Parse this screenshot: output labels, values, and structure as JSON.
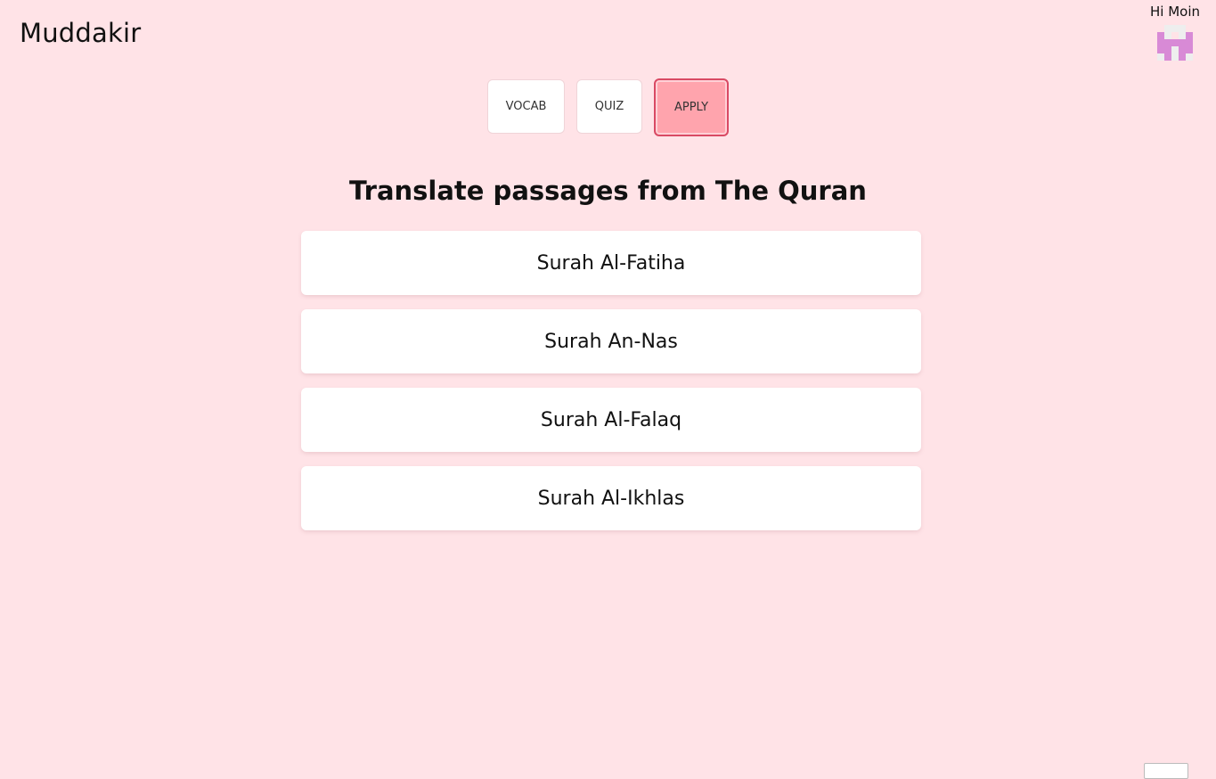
{
  "header": {
    "app_title": "Muddakir",
    "greeting": "Hi Moin",
    "avatar_icon": "pixel-avatar-icon",
    "avatar_color": "#d88ad6"
  },
  "tabs": [
    {
      "label": "VOCAB",
      "active": false
    },
    {
      "label": "QUIZ",
      "active": false
    },
    {
      "label": "APPLY",
      "active": true
    }
  ],
  "main": {
    "heading": "Translate passages from The Quran",
    "surahs": [
      {
        "label": "Surah Al-Fatiha"
      },
      {
        "label": "Surah An-Nas"
      },
      {
        "label": "Surah Al-Falaq"
      },
      {
        "label": "Surah Al-Ikhlas"
      }
    ]
  },
  "colors": {
    "background": "#ffe3e7",
    "active_tab_fill": "#ffa4ad",
    "active_tab_border": "#d94a64",
    "card": "#ffffff"
  }
}
